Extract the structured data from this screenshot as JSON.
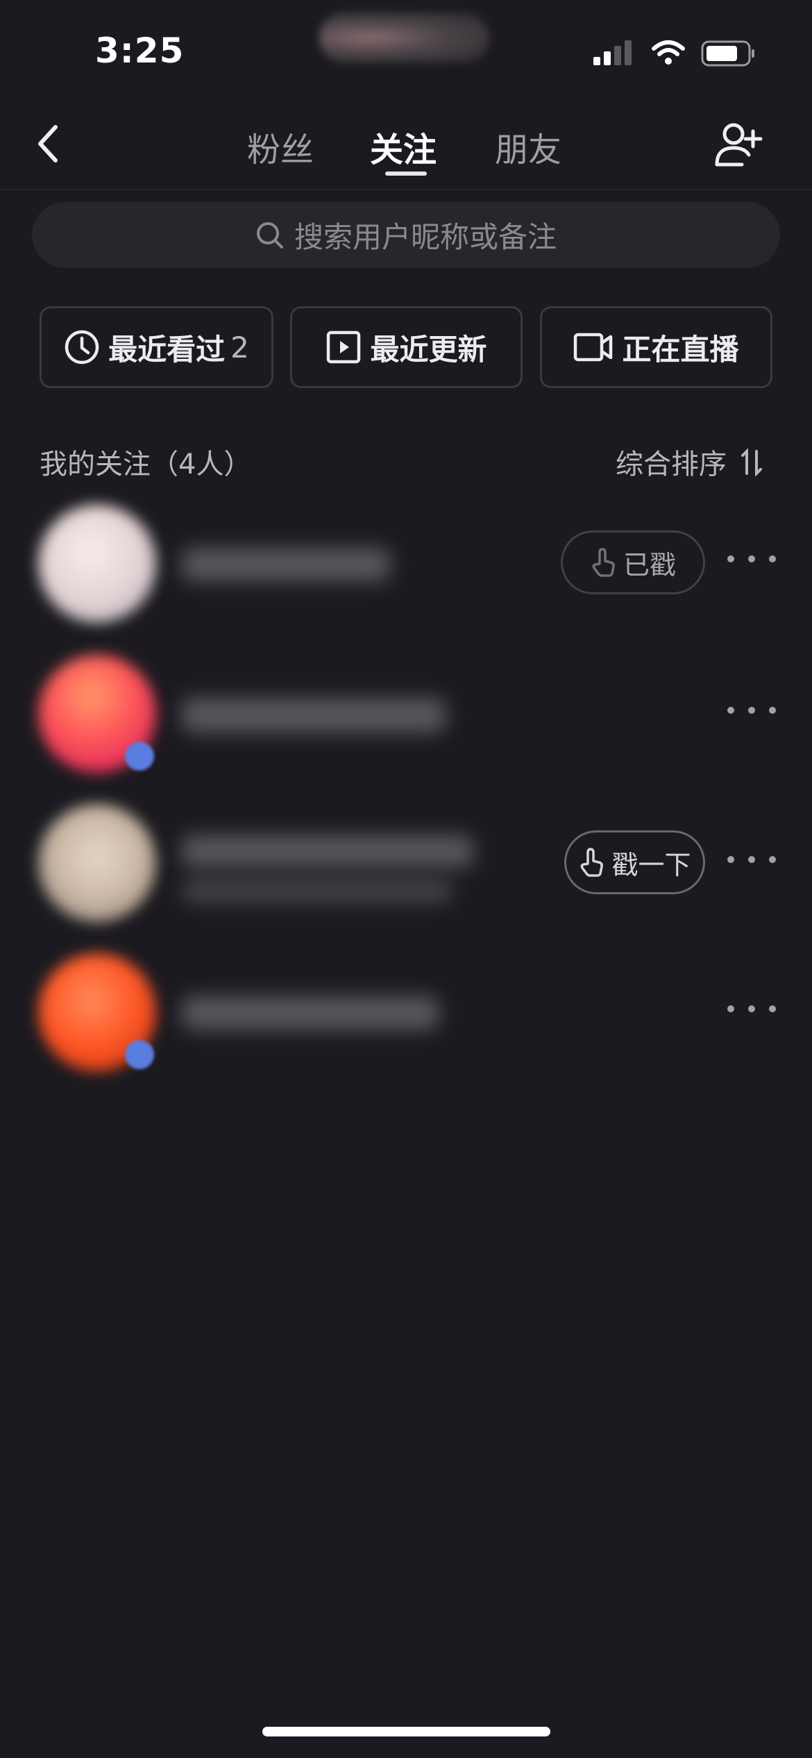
{
  "status_bar": {
    "time": "3:25"
  },
  "header": {
    "tabs": [
      {
        "label": "粉丝"
      },
      {
        "label": "关注",
        "active": true
      },
      {
        "label": "朋友"
      }
    ],
    "icons": {
      "back": "chevron-left-icon",
      "add_friend": "user-plus-icon"
    }
  },
  "search": {
    "placeholder": "搜索用户昵称或备注"
  },
  "filters": {
    "recent": {
      "label": "最近看过",
      "count": "2",
      "icon": "clock-icon"
    },
    "updated": {
      "label": "最近更新",
      "icon": "play-square-icon"
    },
    "live": {
      "label": "正在直播",
      "icon": "video-camera-icon"
    }
  },
  "list": {
    "title": "我的关注（4人）",
    "sort_label": "综合排序",
    "sort_icon": "sort-arrows-icon",
    "rows": [
      {
        "action_label": "已戳",
        "action_icon": "tap-hand-icon",
        "verified": false
      },
      {
        "verified": true
      },
      {
        "action_label": "戳一下",
        "action_icon": "tap-hand-icon",
        "verified": false
      },
      {
        "verified": true
      }
    ]
  },
  "colors": {
    "background": "#1b1a20",
    "active_tab": "#ffffff",
    "inactive_tab": "#9e9ea4",
    "verified_badge": "#5a7de0"
  }
}
